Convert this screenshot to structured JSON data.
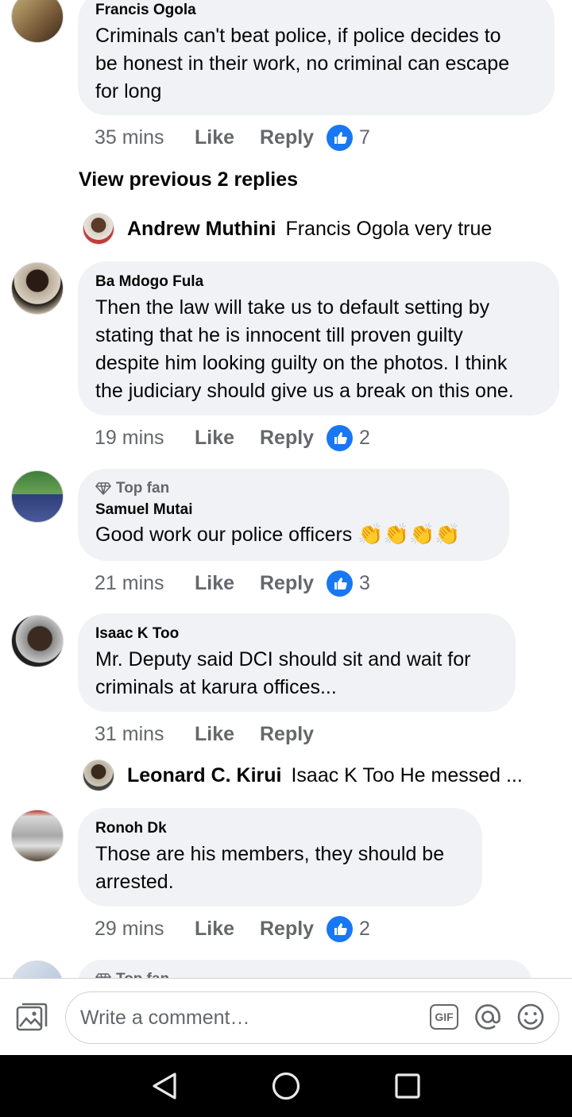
{
  "comments": [
    {
      "author": "Francis Ogola",
      "lines": [
        "Criminals can't beat police, if police decides to",
        "be honest in their work, no criminal can escape",
        "for long"
      ],
      "time": "35 mins",
      "like": "Like",
      "reply": "Reply",
      "reactions": "7"
    },
    {
      "author": "Ba Mdogo Fula",
      "lines": [
        "Then the law will take us to default setting by",
        "stating that he is innocent till proven guilty",
        "despite him looking guilty on the photos. I think",
        "the judiciary should give us a break on this one."
      ],
      "time": "19 mins",
      "like": "Like",
      "reply": "Reply",
      "reactions": "2"
    },
    {
      "badge": "Top fan",
      "author": "Samuel Mutai",
      "text": "Good work our police officers",
      "emojis": "👏👏👏👏",
      "time": "21 mins",
      "like": "Like",
      "reply": "Reply",
      "reactions": "3"
    },
    {
      "author": "Isaac K Too",
      "lines": [
        "Mr. Deputy said DCI should sit and wait for",
        "criminals at karura offices..."
      ],
      "time": "31 mins",
      "like": "Like",
      "reply": "Reply"
    },
    {
      "author": "Ronoh Dk",
      "lines": [
        "Those are his members, they should be",
        "arrested."
      ],
      "time": "29 mins",
      "like": "Like",
      "reply": "Reply",
      "reactions": "2"
    },
    {
      "badge": "Top fan"
    }
  ],
  "view_previous": "View previous 2 replies",
  "replies": [
    {
      "author": "Andrew Muthini",
      "text": "Francis Ogola very true"
    },
    {
      "author": "Leonard C. Kirui",
      "text": "Isaac K Too He messed ..."
    }
  ],
  "composer": {
    "placeholder": "Write a comment…",
    "gif_label": "GIF"
  },
  "colors": {
    "like_blue": "#1877f2",
    "bubble": "#f0f2f5",
    "secondary_text": "#65676b"
  }
}
